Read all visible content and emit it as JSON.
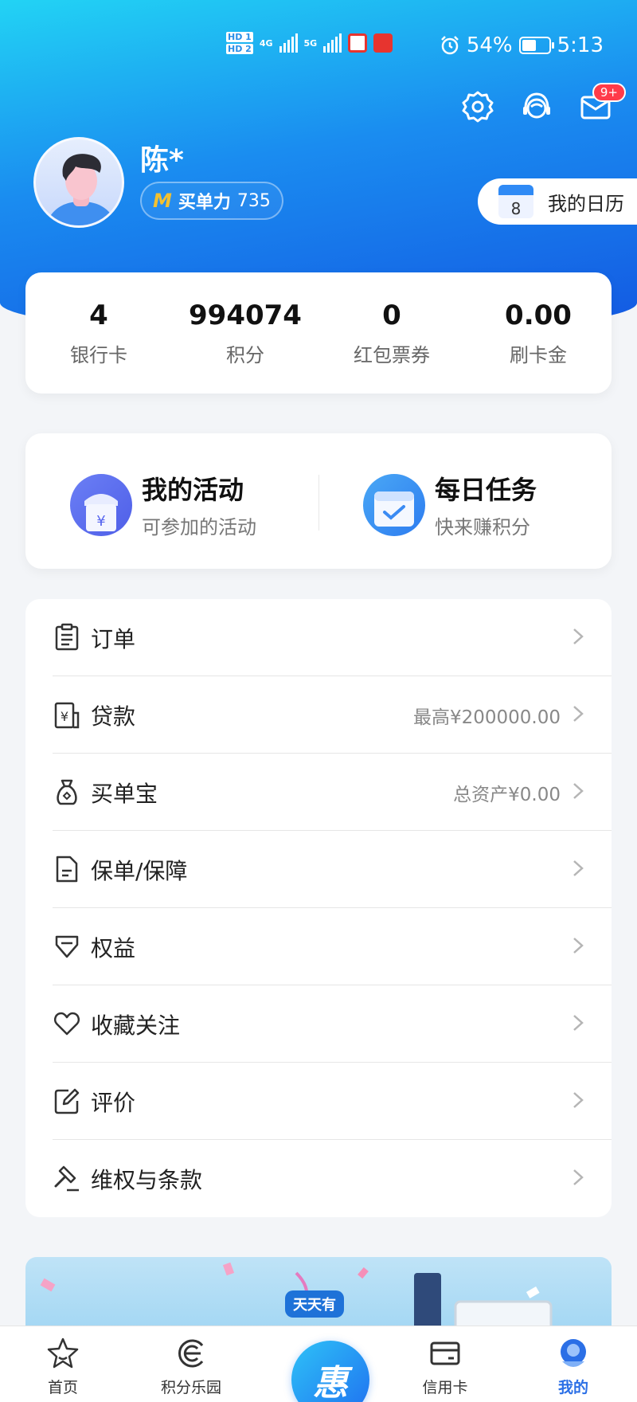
{
  "status_bar": {
    "hd1": "HD 1",
    "hd2": "HD 2",
    "net1": "4G",
    "net2": "5G",
    "battery_percent": "54%",
    "battery_level": 0.54,
    "time": "5:13"
  },
  "header": {
    "message_badge": "9+"
  },
  "profile": {
    "name": "陈*",
    "power_badge": "M",
    "power_label": "买单力",
    "power_value": "735",
    "calendar_day": "8",
    "calendar_label": "我的日历"
  },
  "stats": [
    {
      "value": "4",
      "label": "银行卡"
    },
    {
      "value": "994074",
      "label": "积分"
    },
    {
      "value": "0",
      "label": "红包票券"
    },
    {
      "value": "0.00",
      "label": "刷卡金"
    }
  ],
  "activities": [
    {
      "title": "我的活动",
      "subtitle": "可参加的活动"
    },
    {
      "title": "每日任务",
      "subtitle": "快来赚积分"
    }
  ],
  "menu": [
    {
      "label": "订单",
      "value": ""
    },
    {
      "label": "贷款",
      "value": "最高¥200000.00"
    },
    {
      "label": "买单宝",
      "value": "总资产¥0.00"
    },
    {
      "label": "保单/保障",
      "value": ""
    },
    {
      "label": "权益",
      "value": ""
    },
    {
      "label": "收藏关注",
      "value": ""
    },
    {
      "label": "评价",
      "value": ""
    },
    {
      "label": "维权与条款",
      "value": ""
    }
  ],
  "banner": {
    "tag": "天天有"
  },
  "tabbar": [
    {
      "label": "首页"
    },
    {
      "label": "积分乐园"
    },
    {
      "label": "惠"
    },
    {
      "label": "信用卡"
    },
    {
      "label": "我的"
    }
  ],
  "colors": {
    "accent": "#1f6ff0",
    "hero_start": "#22d3f4",
    "hero_end": "#1358e2",
    "badge_red": "#ff3b4a",
    "active_tab": "#2b6fe6"
  }
}
